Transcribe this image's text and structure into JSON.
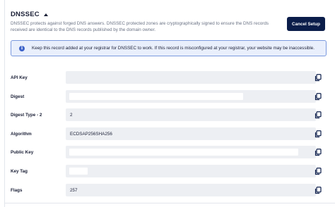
{
  "section": {
    "title": "DNSSEC",
    "description": "DNSSEC protects against forged DNS answers. DNSSEC protected zones are cryptographically signed to ensure the DNS records received are identical to the DNS records published by the domain owner.",
    "cancel_label": "Cancel Setup"
  },
  "alert": {
    "icon": "info-icon",
    "text": "Keep this record added at your registrar for DNSSEC to work. If this record is misconfigured at your registrar, your website may be inaccessible."
  },
  "fields": [
    {
      "label": "API Key",
      "value": ""
    },
    {
      "label": "Digest",
      "value": ""
    },
    {
      "label": "Digest Type - 2",
      "value": "2"
    },
    {
      "label": "Algorithm",
      "value": "ECDSAP256SHA256"
    },
    {
      "label": "Public Key",
      "value": ""
    },
    {
      "label": "Key Tag",
      "value": ""
    },
    {
      "label": "Flags",
      "value": "257"
    }
  ],
  "colors": {
    "primary_button": "#0b1d4a",
    "alert_bg": "#e9effc",
    "alert_border": "#7a99de",
    "field_bg": "#edeff3"
  }
}
